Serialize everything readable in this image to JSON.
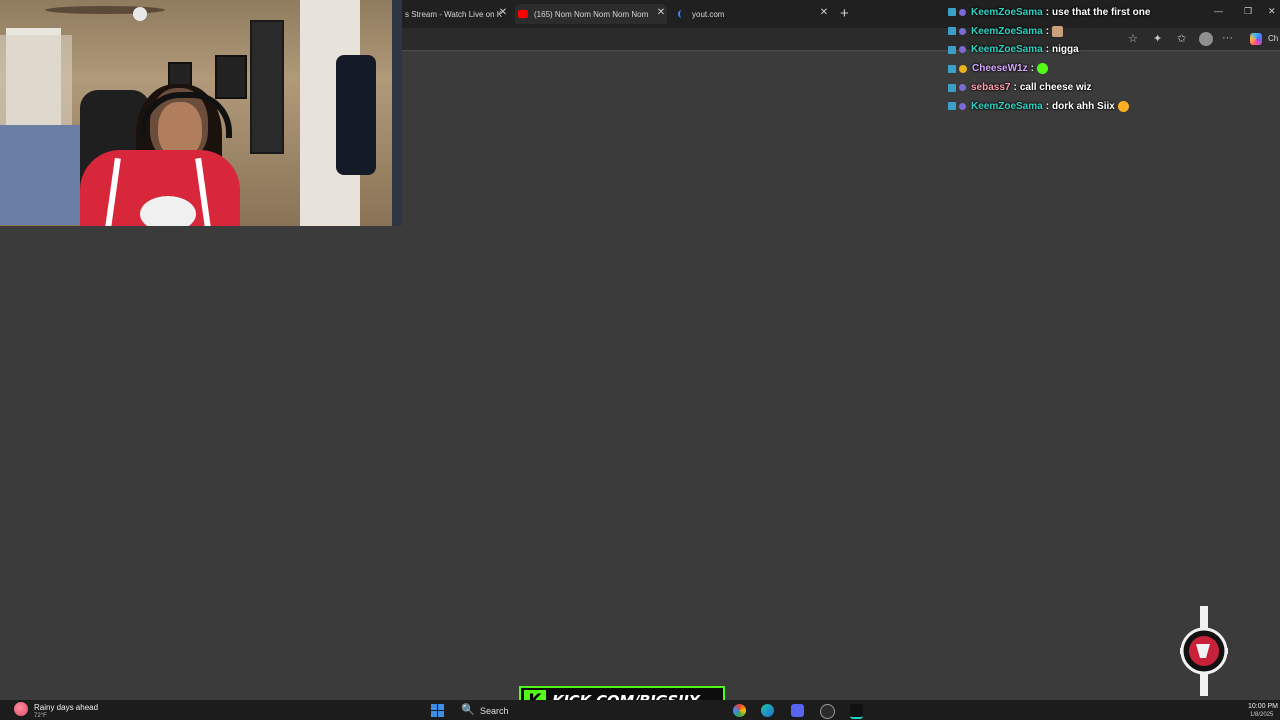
{
  "browser": {
    "tabs": [
      {
        "title": "s Stream - Watch Live on K",
        "close": "✕"
      },
      {
        "title": "(165) Nom Nom Nom Nom Nom",
        "close": "✕"
      },
      {
        "title": "yout.com",
        "close": "✕"
      }
    ],
    "new_tab_label": "+",
    "window_controls": {
      "minimize": "—",
      "restore": "❐",
      "close": "✕"
    },
    "toolbar_right_label": "Ch",
    "icons": {
      "favorite": "☆",
      "extensions": "✦",
      "favorites_bar": "✩",
      "more": "···"
    }
  },
  "chat": {
    "messages": [
      {
        "user": "KeemZoeSama",
        "user_color": "#2fd3c3",
        "text": "use that the first one",
        "badges": [
          "mod",
          "sub"
        ]
      },
      {
        "user": "KeemZoeSama",
        "user_color": "#2fd3c3",
        "text": "",
        "badges": [
          "mod",
          "sub"
        ],
        "emote_color": "#c8a07a"
      },
      {
        "user": "KeemZoeSama",
        "user_color": "#2fd3c3",
        "text": "nigga",
        "badges": [
          "mod",
          "sub"
        ]
      },
      {
        "user": "CheeseW1z",
        "user_color": "#d4a6ff",
        "text": "",
        "badges": [
          "mod",
          "gold"
        ],
        "emote_color": "#53fc18"
      },
      {
        "user": "sebass7",
        "user_color": "#ff9db0",
        "text": "call cheese wiz",
        "badges": [
          "mod",
          "sub"
        ]
      },
      {
        "user": "KeemZoeSama",
        "user_color": "#2fd3c3",
        "text": "dork ahh Siix",
        "badges": [
          "mod",
          "sub"
        ],
        "emote_color": "#ffb020"
      }
    ],
    "separator": ":"
  },
  "taskbar": {
    "weather_title": "Rainy days ahead",
    "weather_temp": "72°F",
    "search_label": "Search",
    "search_icon": "🔍",
    "clock_time": "10:00 PM",
    "clock_date": "1/8/2025"
  },
  "overlay": {
    "kick_url": "KICK.COM/BIGSIIX",
    "kick_letter": "K",
    "brand_color": "#53fc18"
  },
  "colors": {
    "page_background": "#3b3b3b",
    "tabbar": "#202020"
  }
}
